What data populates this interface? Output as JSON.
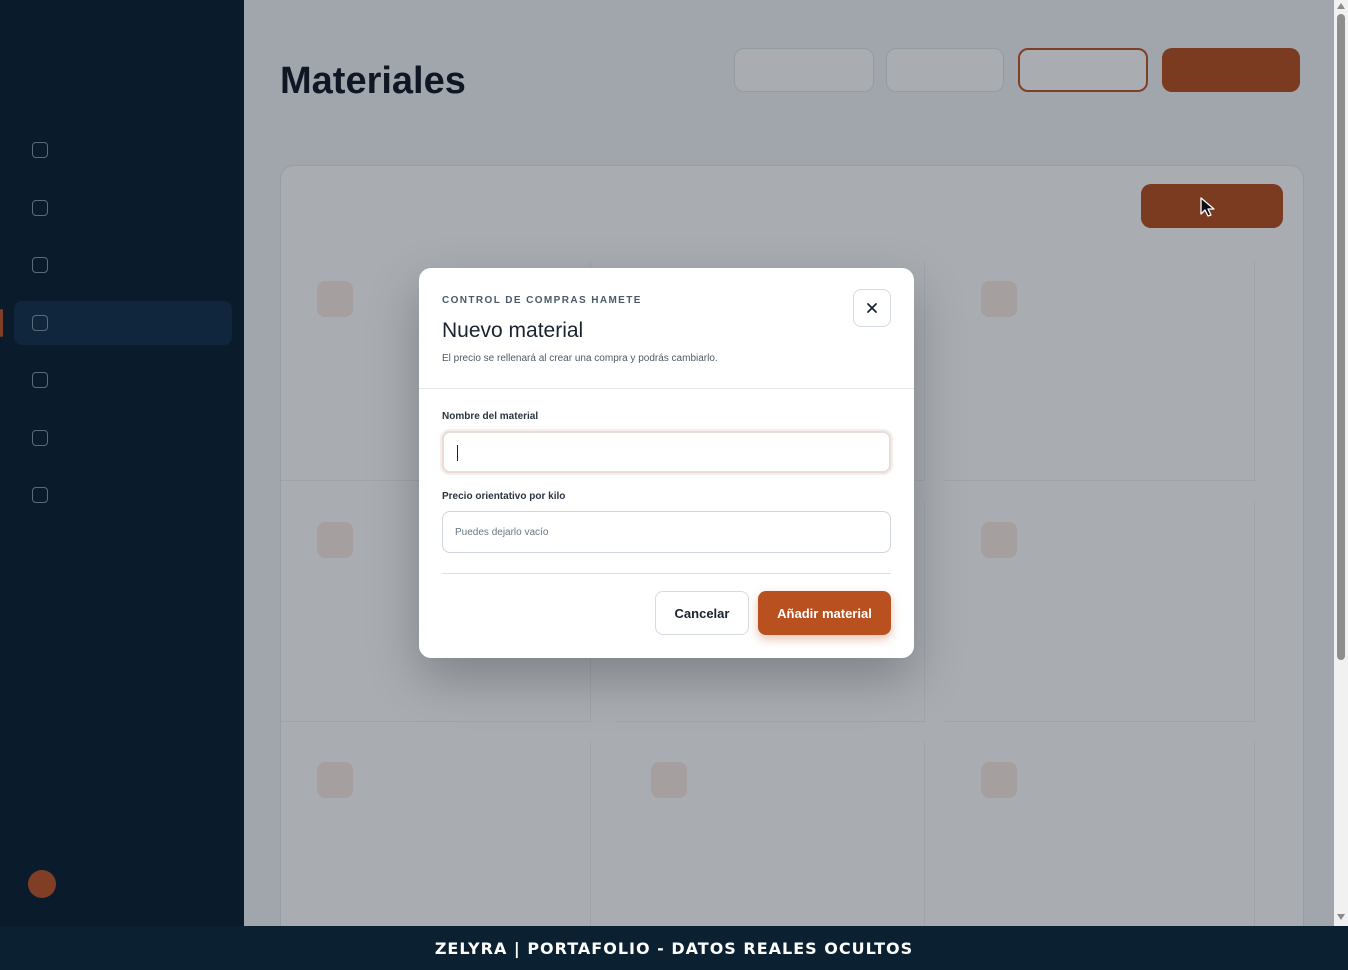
{
  "modal": {
    "eyebrow": "CONTROL DE COMPRAS HAMETE",
    "title": "Nuevo material",
    "description": "El precio se rellenará al crear una compra y podrás cambiarlo.",
    "close_icon": "close-icon",
    "name_field": {
      "label": "Nombre del material",
      "value": ""
    },
    "price_field": {
      "label": "Precio orientativo por kilo",
      "placeholder": "Puedes dejarlo vacío"
    },
    "cancel_label": "Cancelar",
    "add_label": "Añadir material"
  },
  "page": {
    "title": "Materiales"
  },
  "banner": {
    "text": "ZELYRA | PORTAFOLIO - DATOS REALES OCULTOS"
  },
  "colors": {
    "accent": "#b8501f",
    "sidebar": "#0b2132",
    "overlay": "rgba(8,20,34,0.35)"
  },
  "icons": {
    "cursor": "cursor-arrow-icon",
    "close": "close-icon"
  }
}
